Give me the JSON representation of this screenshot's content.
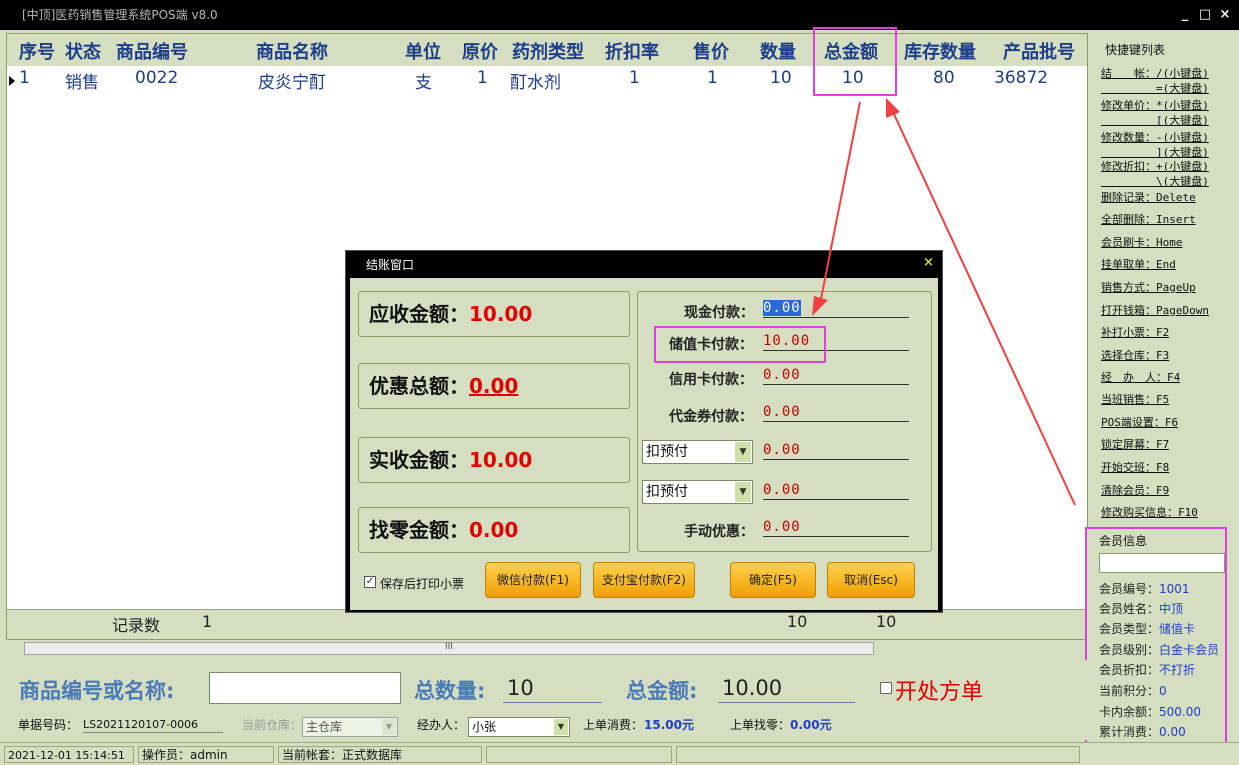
{
  "window": {
    "title": "[中顶]医药销售管理系统POS端 v8.0",
    "min": "_",
    "max": "□",
    "close": "×"
  },
  "grid": {
    "headers": [
      "序号",
      "状态",
      "商品编号",
      "商品名称",
      "单位",
      "原价",
      "药剂类型",
      "折扣率",
      "售价",
      "数量",
      "总金额",
      "库存数量",
      "产品批号"
    ],
    "rows": [
      {
        "seq": "1",
        "status": "销售",
        "code": "0022",
        "name": "皮炎宁酊",
        "unit": "支",
        "orig_price": "1",
        "type": "酊水剂",
        "discount": "1",
        "price": "1",
        "qty": "10",
        "total": "10",
        "stock": "80",
        "batch": "36872"
      }
    ],
    "footer": {
      "label": "记录数",
      "count": "1",
      "qty_sum": "10",
      "total_sum": "10"
    },
    "scroll_mark": "III"
  },
  "shortcuts": {
    "title": "快捷键列表",
    "items": [
      "结　　帐：/(小键盘)",
      "　　　　　=(大键盘)",
      "修改单价：*(小键盘)",
      "　　　　　[(大键盘)",
      "修改数量：-(小键盘)",
      "　　　　　](大键盘)",
      "修改折扣：+(小键盘)",
      "　　　　　\\(大键盘)",
      "删除记录：Delete",
      "全部删除：Insert",
      "会员刷卡：Home",
      "挂单取单：End",
      "销售方式：PageUp",
      "打开钱箱：PageDown",
      "补打小票：F2",
      "选择仓库：F3",
      "经　办　人：F4",
      "当班销售：F5",
      "POS端设置：F6",
      "锁定屏幕：F7",
      "开始交班：F8",
      "清除会员：F9",
      "修改购买信息：F10"
    ]
  },
  "member": {
    "title": "会员信息",
    "search_value": "",
    "fields": [
      {
        "label": "会员编号：",
        "value": "1001"
      },
      {
        "label": "会员姓名：",
        "value": "中顶"
      },
      {
        "label": "会员类型：",
        "value": "储值卡"
      },
      {
        "label": "会员级别：",
        "value": "白金卡会员"
      },
      {
        "label": "会员折扣：",
        "value": "不打折"
      },
      {
        "label": "当前积分：",
        "value": "0"
      },
      {
        "label": "卡内余额：",
        "value": "500.00"
      },
      {
        "label": "累计消费：",
        "value": "0.00"
      }
    ]
  },
  "bottom": {
    "search_label": "商品编号或名称:",
    "search_value": "",
    "qty_label": "总数量:",
    "qty_value": "10",
    "amount_label": "总金额:",
    "amount_value": "10.00",
    "prescription_label": "开处方单",
    "bill_no_label": "单据号码：",
    "bill_no": "LS2021120107-0006",
    "warehouse_label": "当前仓库：",
    "warehouse": "主仓库",
    "handler_label": "经办人：",
    "handler": "小张",
    "last_spend_label": "上单消费：",
    "last_spend": "15.00元",
    "last_change_label": "上单找零：",
    "last_change": "0.00元"
  },
  "status": {
    "datetime": "2021-12-01 15:14:51",
    "operator": "操作员：admin",
    "account": "当前帐套：正式数据库"
  },
  "dialog": {
    "title": "结账窗口",
    "close": "×",
    "receivable_label": "应收金额：",
    "receivable": "10.00",
    "discount_label": "优惠总额：",
    "discount": "0.00",
    "received_label": "实收金额：",
    "received": "10.00",
    "change_label": "找零金额：",
    "change": "0.00",
    "cash_label": "现金付款：",
    "cash": "0.00",
    "stored_card_label": "储值卡付款：",
    "stored_card": "10.00",
    "credit_label": "信用卡付款：",
    "credit": "0.00",
    "voucher_label": "代金券付款：",
    "voucher": "0.00",
    "prepay1": "扣预付",
    "prepay1_value": "0.00",
    "prepay2": "扣预付",
    "prepay2_value": "0.00",
    "manual_label": "手动优惠：",
    "manual": "0.00",
    "print_label": "保存后打印小票",
    "wechat_btn": "微信付款(F1)",
    "alipay_btn": "支付宝付款(F2)",
    "ok_btn": "确定(F5)",
    "cancel_btn": "取消(Esc)"
  },
  "colors": {
    "accent": "#e040e0",
    "panel": "#d5dec0",
    "header_text": "#1e3e8a",
    "amount_red": "#e00000"
  }
}
